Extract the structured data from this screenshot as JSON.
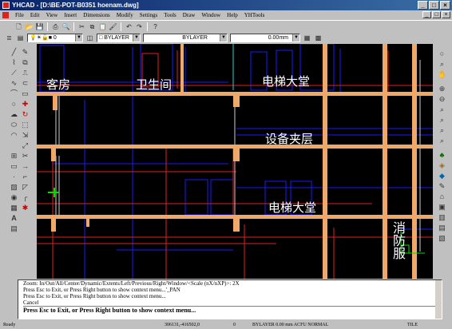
{
  "window": {
    "title": "YHCAD - [D:\\BE-POT-B0351 hoenam.dwg]",
    "min_glyph": "_",
    "max_glyph": "□",
    "close_glyph": "×"
  },
  "menubar": {
    "items": [
      "File",
      "Edit",
      "View",
      "Insert",
      "Dimensions",
      "Modify",
      "Settings",
      "Tools",
      "Draw",
      "Window",
      "Help",
      "YHTools"
    ]
  },
  "toolbar": {
    "icons": [
      "new-icon",
      "open-icon",
      "save-icon",
      "print-icon",
      "preview-icon",
      "cut-icon",
      "copy-icon",
      "paste-icon",
      "match-icon",
      "undo-icon",
      "redo-icon",
      "help-icon"
    ],
    "layer_value": "0",
    "color_value": "BYLAYER",
    "linetype_value": "BYLAYER",
    "lineweight_value": "0.00mm"
  },
  "drawing": {
    "labels": {
      "guest_room": "客房",
      "restroom": "卫生间",
      "elevator_lobby_top": "电梯大堂",
      "mezzanine": "设备夹层",
      "elevator_lobby_mid": "电梯大堂",
      "fire_service": "消防服"
    },
    "colors": {
      "background": "#000000",
      "slab": "#f0a868",
      "blue_lines": "#1a1aff",
      "red_lines": "#e02020",
      "cursor": "#00e000"
    }
  },
  "command": {
    "lines": [
      "Zoom: In/Out/All/Center/Dynamic/Extents/Left/Previous/Right/Window/<Scale (nX/nXP)>: 2X",
      "Press Esc to Exit, or Press Right button to show context menu...'_PAN",
      "Press Esc to Exit, or Press Right button to show context menu...",
      "Cancel"
    ],
    "prompt": "Press Esc to Exit, or Press Right button to show context menu..."
  },
  "status": {
    "ready": "Ready",
    "coords": "306131,-416502,0",
    "z": "0",
    "info": "BYLAYER  0.00 mm  ACFU  NORMAL",
    "tile": "TILE"
  }
}
